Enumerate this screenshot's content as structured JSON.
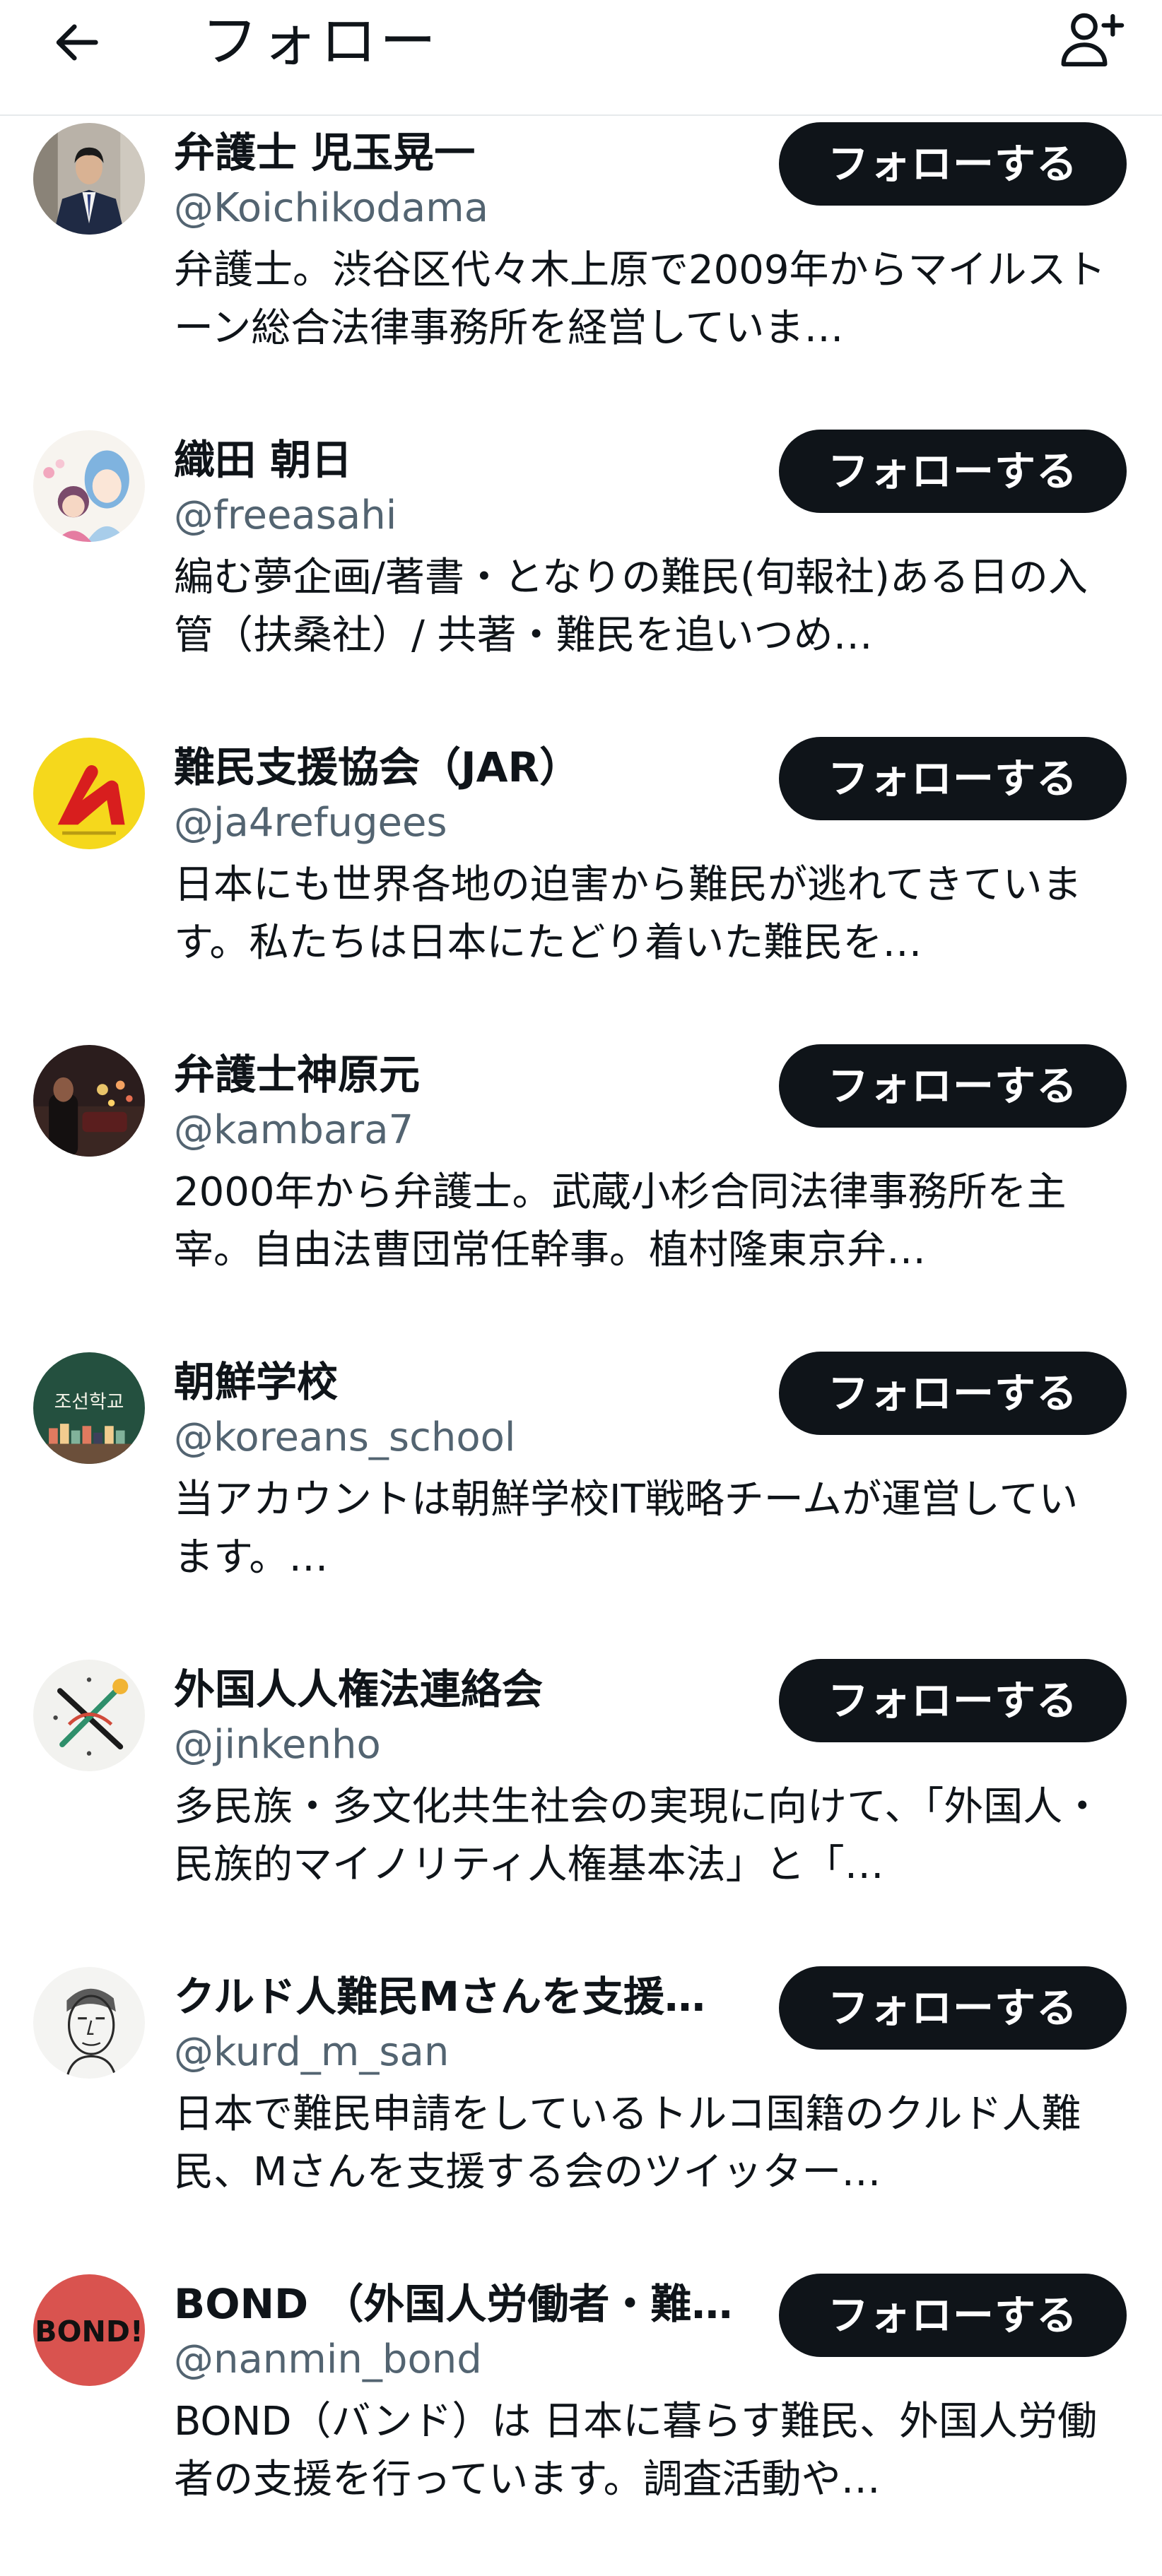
{
  "header": {
    "title": "フォロー",
    "back_icon": "arrow-left-icon",
    "add_user_icon": "person-plus-icon"
  },
  "colors": {
    "button_bg": "#0f1419",
    "button_text": "#ffffff",
    "handle": "#536471",
    "divider": "#e6e9eb"
  },
  "accounts": [
    {
      "name": "弁護士 児玉晃一",
      "handle": "@Koichikodama",
      "bio": "弁護士。渋谷区代々木上原で2009年からマイルストーン総合法律事務所を経営していま…",
      "follow_label": "フォローする",
      "avatar_icon": "man-in-suit-avatar"
    },
    {
      "name": "織田 朝日",
      "handle": "@freeasahi",
      "bio": "編む夢企画/著書・となりの難民(旬報社)ある日の入管（扶桑社）/ 共著・難民を追いつめ…",
      "follow_label": "フォローする",
      "avatar_icon": "illustration-avatar"
    },
    {
      "name": "難民支援協会（JAR）",
      "handle": "@ja4refugees",
      "bio": "日本にも世界各地の迫害から難民が逃れてきています。私たちは日本にたどり着いた難民を…",
      "follow_label": "フォローする",
      "avatar_icon": "jar-logo-avatar"
    },
    {
      "name": "弁護士神原元",
      "handle": "@kambara7",
      "bio": "2000年から弁護士。武蔵小杉合同法律事務所を主宰。自由法曹団常任幹事。植村隆東京弁…",
      "follow_label": "フォローする",
      "avatar_icon": "night-street-avatar"
    },
    {
      "name": "朝鮮学校",
      "handle": "@koreans_school",
      "bio": "当アカウントは朝鮮学校IT戦略チームが運営しています。…",
      "follow_label": "フォローする",
      "avatar_icon": "chalkboard-avatar",
      "avatar_text": "조선학교"
    },
    {
      "name": "外国人人権法連絡会",
      "handle": "@jinkenho",
      "bio": "多民族・多文化共生社会の実現に向けて、「外国人・民族的マイノリティ人権基本法」と「…",
      "follow_label": "フォローする",
      "avatar_icon": "compass-logo-avatar"
    },
    {
      "name": "クルド人難民Mさんを支援…",
      "handle": "@kurd_m_san",
      "bio": "日本で難民申請をしているトルコ国籍のクルド人難民、Mさんを支援する会のツイッター…",
      "follow_label": "フォローする",
      "avatar_icon": "sketch-face-avatar"
    },
    {
      "name": "BOND （外国人労働者・難…",
      "handle": "@nanmin_bond",
      "bio": "BOND（バンド）は 日本に暮らす難民、外国人労働者の支援を行っています。調査活動や…",
      "follow_label": "フォローする",
      "avatar_icon": "bond-logo-avatar",
      "avatar_text": "BOND!"
    }
  ]
}
